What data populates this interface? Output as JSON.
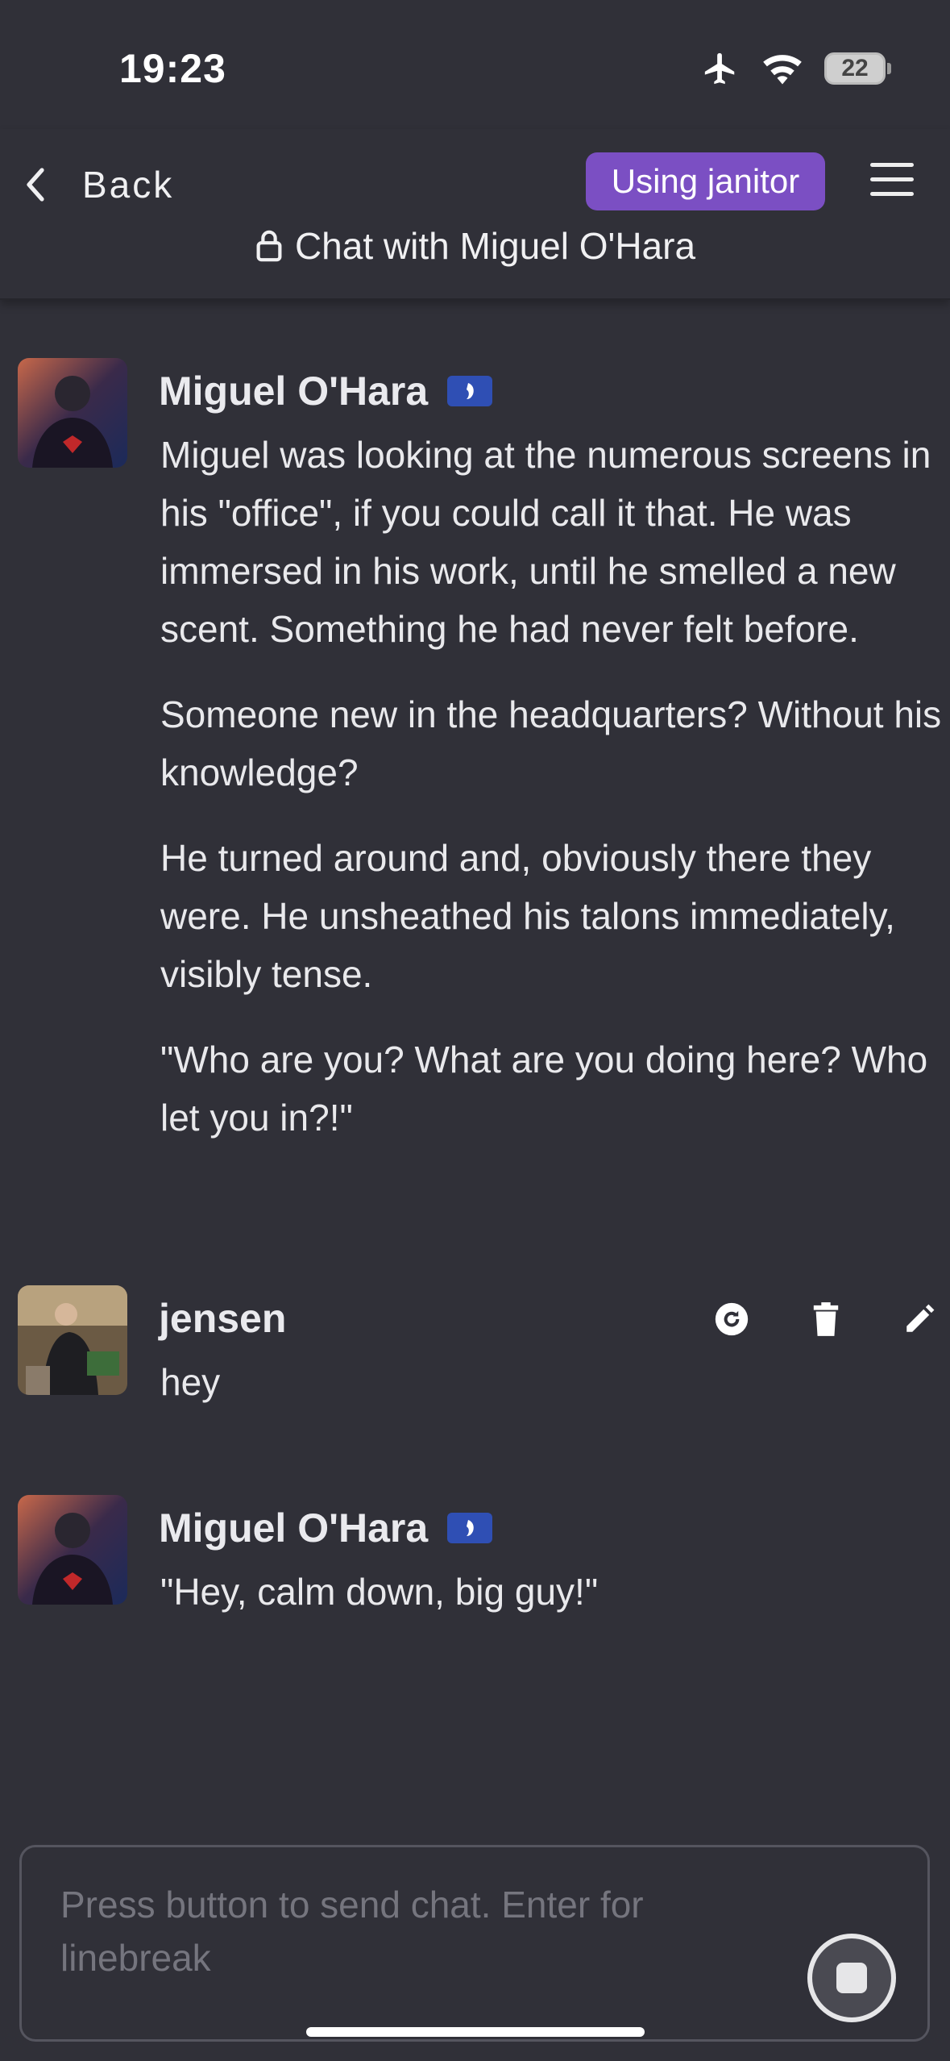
{
  "status_bar": {
    "time": "19:23",
    "battery": "22"
  },
  "header": {
    "back_label": "Back",
    "model_badge": "Using janitor",
    "title": "Chat with Miguel O'Hara"
  },
  "messages": [
    {
      "author": "Miguel O'Hara",
      "is_bot": true,
      "paragraphs": [
        "Miguel was looking at the numerous screens in his \"office\", if you could call it that. He was immersed in his work, until he smelled a new scent. Something he had never felt before.",
        "Someone new in the headquarters? Without his knowledge?",
        "He turned around and, obviously there they were. He unsheathed his talons immediately, visibly tense.",
        "\"Who are you? What are you doing here? Who let you in?!\""
      ]
    },
    {
      "author": "jensen",
      "is_bot": false,
      "paragraphs": [
        "hey"
      ]
    },
    {
      "author": "Miguel O'Hara",
      "is_bot": true,
      "paragraphs": [
        "\"Hey, calm down, big guy!\""
      ]
    }
  ],
  "composer": {
    "placeholder": "Press button to send chat. Enter for linebreak",
    "value": ""
  },
  "colors": {
    "background": "#303038",
    "accent": "#7b4fc3",
    "bot_badge": "#2f4fb4"
  }
}
